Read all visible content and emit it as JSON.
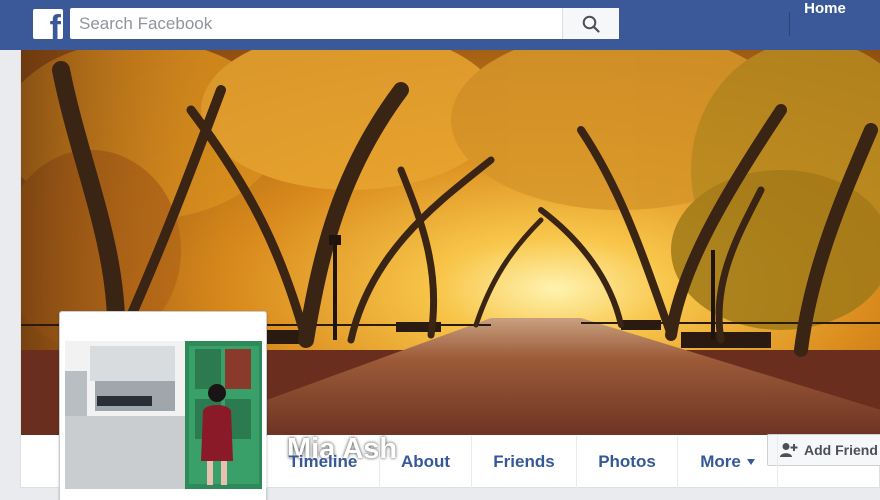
{
  "topbar": {
    "logo_icon": "facebook-f-icon",
    "logo_glyph": "f",
    "search_placeholder": "Search Facebook",
    "search_icon": "search-icon",
    "home_label": "Home",
    "brand_color": "#3b5998"
  },
  "profile": {
    "name": "Mia Ash",
    "cover_icon": "autumn-park-cover-image",
    "photo_icon": "profile-photo-image",
    "add_friend_icon": "add-friend-icon",
    "add_friend_label": "Add Friend"
  },
  "tabs": [
    {
      "label": "Timeline"
    },
    {
      "label": "About"
    },
    {
      "label": "Friends"
    },
    {
      "label": "Photos"
    },
    {
      "label": "More",
      "icon": "caret-down-icon"
    }
  ]
}
